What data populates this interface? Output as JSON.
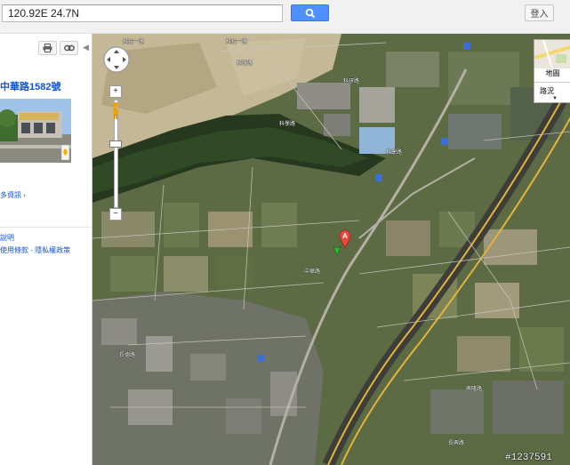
{
  "search": {
    "query": "120.92E 24.7N",
    "button_icon": "search-icon",
    "login_label": "登入",
    "accent": "#4d90fe"
  },
  "panel": {
    "place_title": "中華路1582號",
    "more_info": "多資訊 ›",
    "help": "說明",
    "terms": "使用條款 - 隱私權政策",
    "print_icon": "print-icon",
    "link_icon": "link-icon",
    "collapse_icon": "chevron-left-icon"
  },
  "map": {
    "marker_letter": "A",
    "maptype_label": "地圖",
    "traffic_label": "路況",
    "labels": [
      "科技一路",
      "科技一路",
      "科研路",
      "科研路",
      "科學路",
      "科學路",
      "中華路",
      "興隆路",
      "長德路",
      "長興路"
    ],
    "route_badges": [
      "1",
      "1",
      "1",
      "1"
    ],
    "watermark": "#1237591"
  }
}
